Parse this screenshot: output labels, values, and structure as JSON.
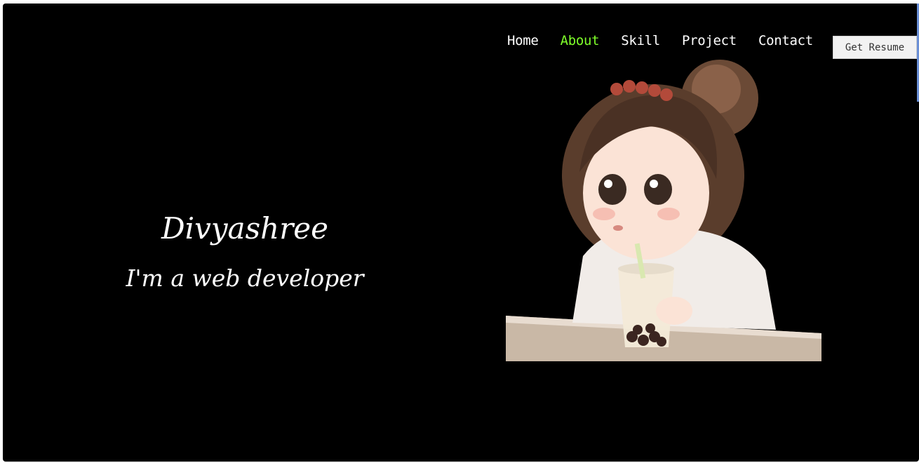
{
  "nav": {
    "items": [
      {
        "label": "Home",
        "active": false
      },
      {
        "label": "About",
        "active": true
      },
      {
        "label": "Skill",
        "active": false
      },
      {
        "label": "Project",
        "active": false
      },
      {
        "label": "Contact",
        "active": false
      }
    ],
    "resume_button": "Get Resume"
  },
  "hero": {
    "name": "Divyashree",
    "subtitle": "I'm a web developer"
  },
  "colors": {
    "background": "#000000",
    "text": "#ffffff",
    "accent": "#7fff2a"
  }
}
